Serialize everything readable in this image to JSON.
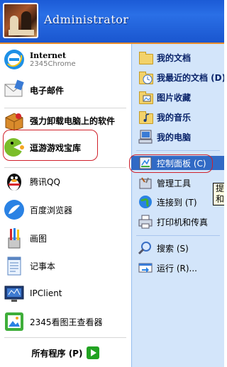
{
  "user": {
    "name": "Administrator"
  },
  "left": {
    "internet": {
      "title": "Internet",
      "subtitle": "2345Chrome"
    },
    "email": "电子邮件",
    "uninstall": "强力卸载电脑上的软件",
    "games": "逗游游戏宝库",
    "qq": "腾讯QQ",
    "baidu": "百度浏览器",
    "paint": "画图",
    "notepad": "记事本",
    "ipclient": "IPClient",
    "viewer": "2345看图王查看器",
    "all_programs": "所有程序 (P)"
  },
  "right": {
    "my_documents": "我的文档",
    "recent": "我最近的文档 (D)",
    "pictures": "图片收藏",
    "music": "我的音乐",
    "computer": "我的电脑",
    "control_panel": "控制面板 (C)",
    "admin_tools": "管理工具",
    "connect": "连接到 (T)",
    "printers": "打印机和传真",
    "search": "搜索 (S)",
    "run": "运行 (R)..."
  },
  "tooltip": {
    "line1": "提",
    "line2": "和"
  },
  "colors": {
    "header": "#1c5bd6",
    "right_panel": "#d3e5fa",
    "highlight": "#316ac5",
    "annotation": "#d0202a"
  }
}
